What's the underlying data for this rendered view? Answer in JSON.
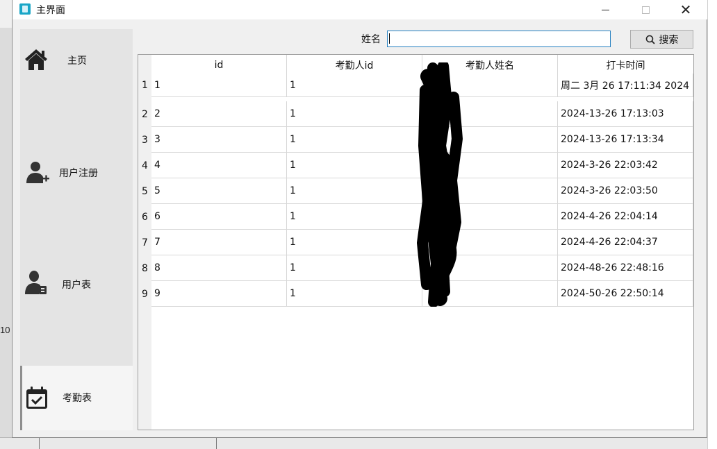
{
  "window": {
    "title": "主界面"
  },
  "background": {
    "edge_number": "10"
  },
  "sidebar": {
    "items": [
      {
        "label": "主页",
        "icon": "home-icon",
        "active": false
      },
      {
        "label": "用户注册",
        "icon": "add-user-icon",
        "active": false
      },
      {
        "label": "用户表",
        "icon": "user-badge-icon",
        "active": false
      },
      {
        "label": "考勤表",
        "icon": "calendar-check-icon",
        "active": true
      }
    ]
  },
  "search": {
    "label": "姓名",
    "value": "",
    "button_label": "搜索"
  },
  "table": {
    "columns": [
      "id",
      "考勤人id",
      "考勤人姓名",
      "打卡时间"
    ],
    "rows": [
      {
        "num": "1",
        "id": "1",
        "uid": "1",
        "name": "",
        "time": "周二 3月 26 17:11:34 2024"
      },
      {
        "num": "2",
        "id": "2",
        "uid": "1",
        "name": "",
        "time": "2024-13-26 17:13:03"
      },
      {
        "num": "3",
        "id": "3",
        "uid": "1",
        "name": "",
        "time": "2024-13-26 17:13:34"
      },
      {
        "num": "4",
        "id": "4",
        "uid": "1",
        "name": "",
        "time": "2024-3-26 22:03:42"
      },
      {
        "num": "5",
        "id": "5",
        "uid": "1",
        "name": "",
        "time": "2024-3-26 22:03:50"
      },
      {
        "num": "6",
        "id": "6",
        "uid": "1",
        "name": "",
        "time": "2024-4-26 22:04:14"
      },
      {
        "num": "7",
        "id": "7",
        "uid": "1",
        "name": "",
        "time": "2024-4-26 22:04:37"
      },
      {
        "num": "8",
        "id": "8",
        "uid": "1",
        "name": "",
        "time": "2024-48-26 22:48:16"
      },
      {
        "num": "9",
        "id": "9",
        "uid": "1",
        "name": "",
        "time": "2024-50-26 22:50:14"
      }
    ]
  }
}
